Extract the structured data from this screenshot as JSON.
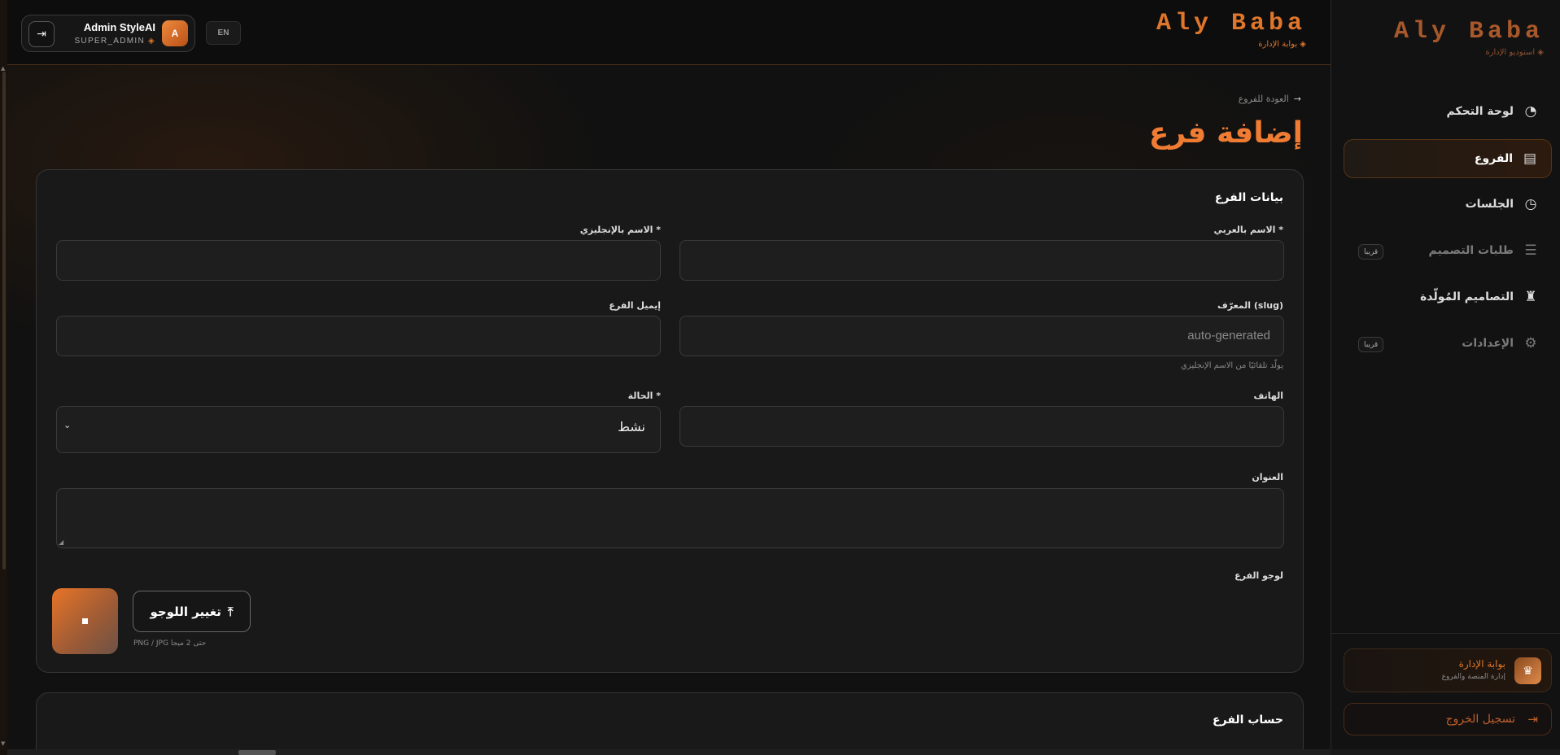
{
  "topbar": {
    "brand": "Aly Baba",
    "portal_label": "بوابة الإدارة",
    "user_name": "Admin StyleAI",
    "user_role": "SUPER_ADMIN",
    "avatar_letter": "A",
    "lang_button": "EN",
    "logout_icon": "logout-icon"
  },
  "page": {
    "back_link": "العودة للفروع",
    "title": "إضافة فرع"
  },
  "form": {
    "section_title": "بيانات الفرع",
    "name_ar_label": "الاسم بالعربي *",
    "name_ar_value": "",
    "name_en_label": "الاسم بالإنجليزي *",
    "name_en_value": "",
    "slug_label": "المعرّف (slug)",
    "slug_placeholder": "auto-generated",
    "slug_hint": "يولّد تلقائيًا من الاسم الإنجليزي",
    "email_label": "إيميل الفرع",
    "email_value": "",
    "phone_label": "الهاتف",
    "phone_value": "",
    "status_label": "الحالة *",
    "status_value": "نشط",
    "address_label": "العنوان",
    "address_value": "",
    "logo_label": "لوجو الفرع",
    "change_logo_button": "تغيير اللوجو",
    "logo_hint": "PNG / JPG حتى 2 ميجا"
  },
  "account_section": {
    "title": "حساب الفرع"
  },
  "sidebar": {
    "brand": "Aly Baba",
    "subtitle": "استوديو الإدارة",
    "items": [
      {
        "label": "لوحة التحكم",
        "icon": "pie-chart-icon",
        "active": false,
        "disabled": false
      },
      {
        "label": "الفروع",
        "icon": "store-icon",
        "active": true,
        "disabled": false
      },
      {
        "label": "الجلسات",
        "icon": "clock-icon",
        "active": false,
        "disabled": false
      },
      {
        "label": "طلبات التصميم",
        "icon": "list-check-icon",
        "active": false,
        "disabled": true,
        "badge": "قريبا"
      },
      {
        "label": "التصاميم المُولّدة",
        "icon": "shirt-icon",
        "active": false,
        "disabled": false
      },
      {
        "label": "الإعدادات",
        "icon": "gear-icon",
        "active": false,
        "disabled": true,
        "badge": "قريبا"
      }
    ],
    "portal_title": "بوابة الإدارة",
    "portal_subtitle": "إدارة المنصة والفروع",
    "logout_label": "تسجيل الخروج"
  },
  "colors": {
    "accent": "#e0762b",
    "background": "#111111",
    "card": "#1a1a1a"
  }
}
